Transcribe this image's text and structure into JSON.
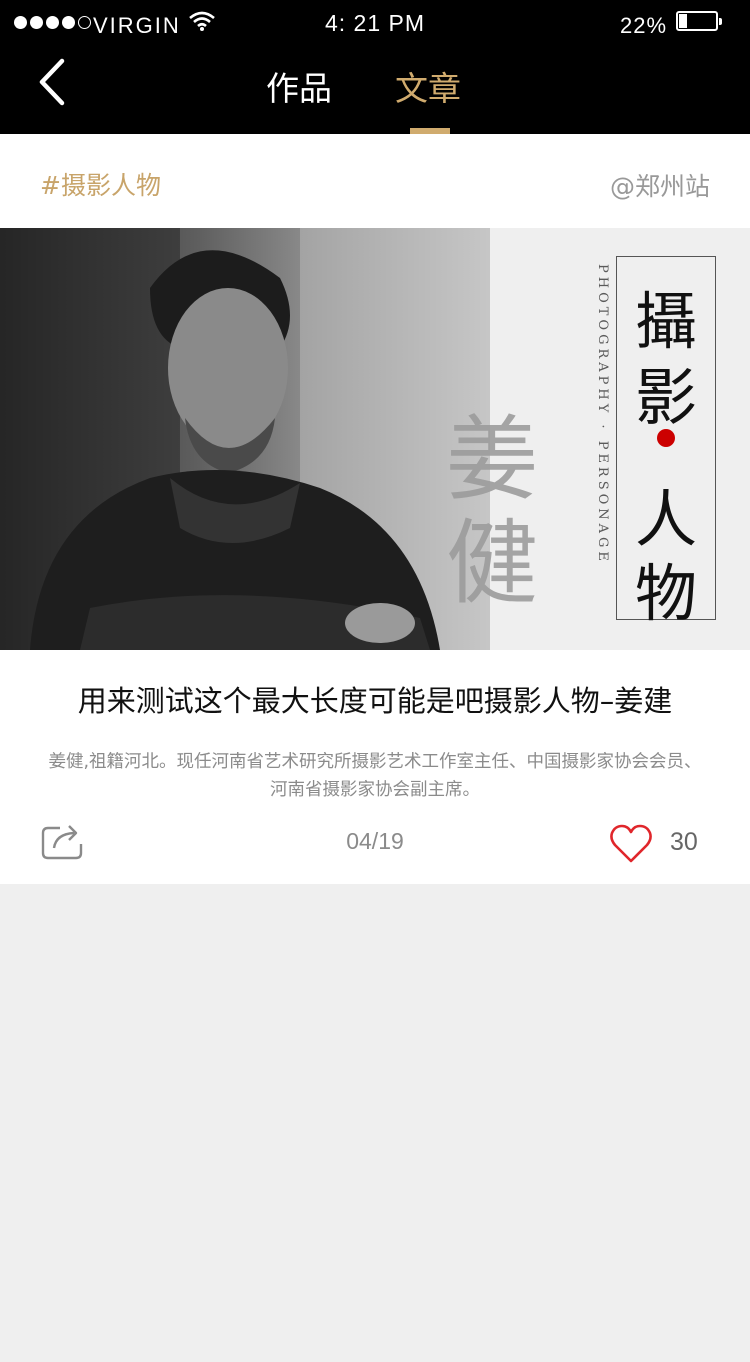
{
  "status_bar": {
    "carrier": "VIRGIN",
    "time": "4: 21 PM",
    "battery": "22%",
    "battery_level": 0.22
  },
  "nav": {
    "tabs": [
      {
        "label": "作品",
        "active": false
      },
      {
        "label": "文章",
        "active": true
      }
    ]
  },
  "header": {
    "tag": "#摄影人物",
    "station": "@郑州站"
  },
  "banner": {
    "name": "姜健",
    "vertical_english": "PHOTOGRAPHY · PERSONAGE",
    "frame_chars": [
      "攝",
      "影",
      "人",
      "物"
    ]
  },
  "article": {
    "title": "用来测试这个最大长度可能是吧摄影人物–姜建",
    "summary": "姜健,祖籍河北。现任河南省艺术研究所摄影艺术工作室主任、中国摄影家协会会员、河南省摄影家协会副主席。",
    "date": "04/19",
    "likes": "30"
  },
  "colors": {
    "accent": "#d0ab6e",
    "like_red": "#e0262b",
    "background": "#efefef"
  },
  "icons": [
    "back-chevron-icon",
    "share-icon",
    "heart-icon",
    "wifi-icon",
    "battery-icon"
  ]
}
